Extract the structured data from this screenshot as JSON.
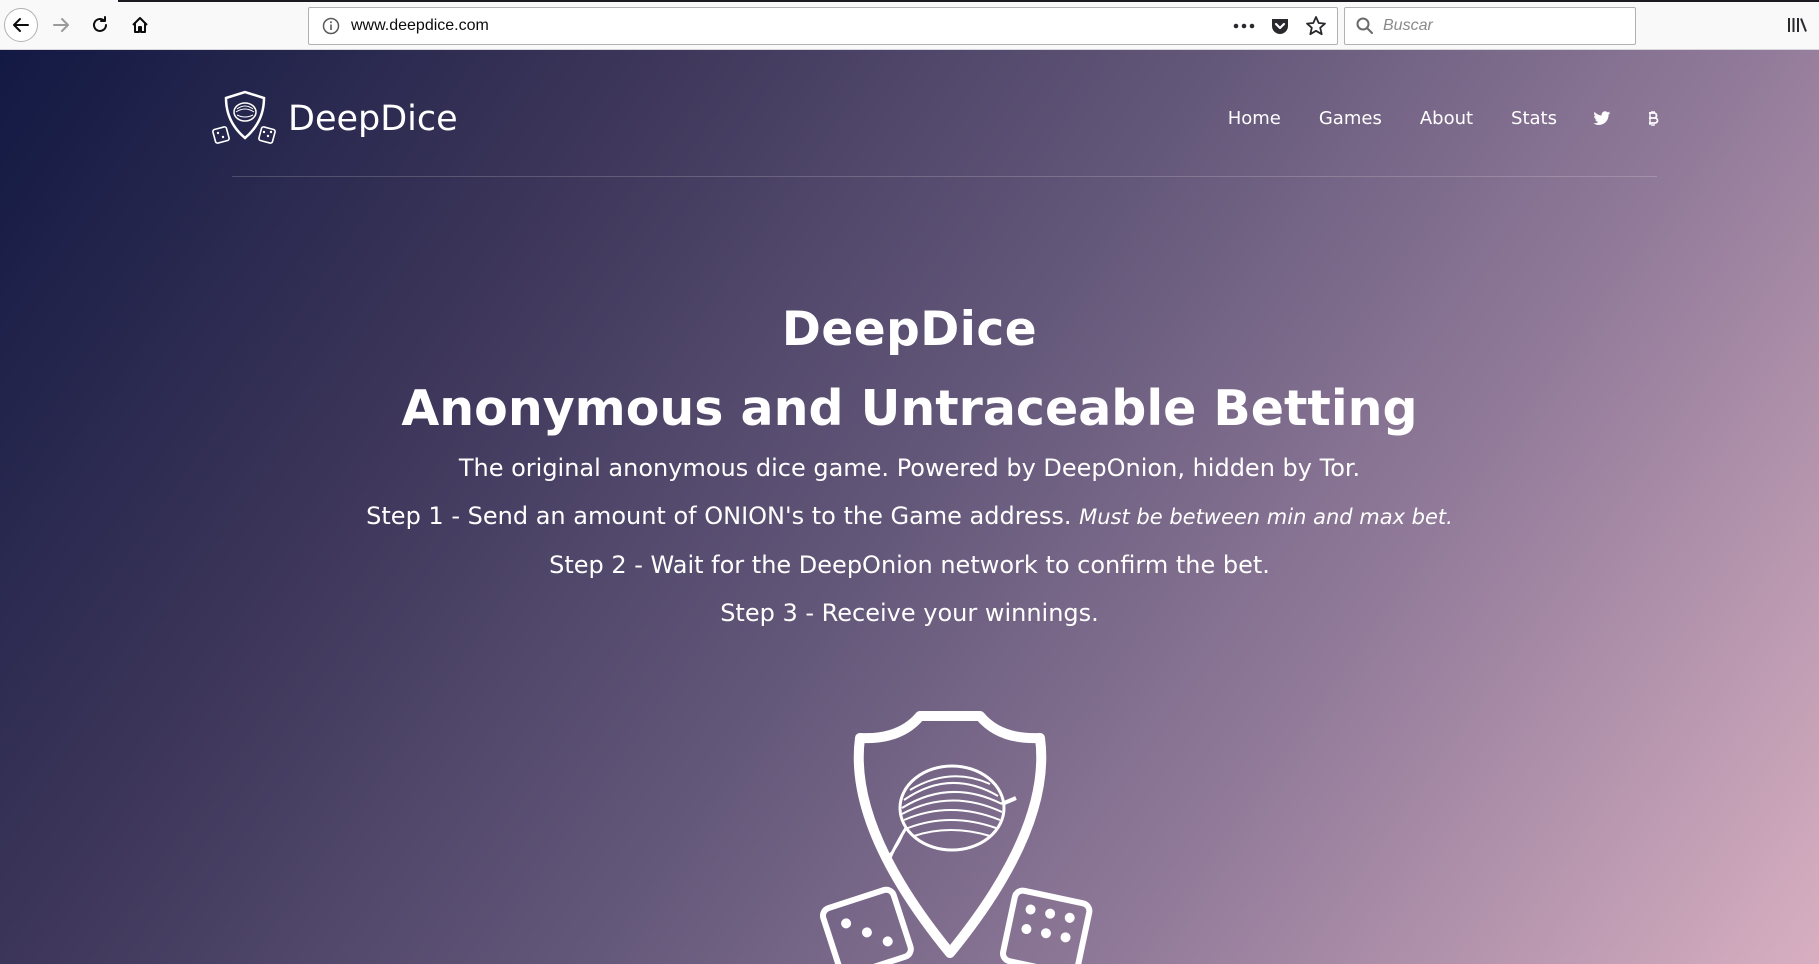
{
  "browser": {
    "url": "www.deepdice.com",
    "search_placeholder": "Buscar"
  },
  "site": {
    "brand": "DeepDice",
    "nav": [
      "Home",
      "Games",
      "About",
      "Stats"
    ]
  },
  "hero": {
    "title": "DeepDice",
    "subtitle": "Anonymous and Untraceable Betting",
    "tagline": "The original anonymous dice game. Powered by DeepOnion, hidden by Tor.",
    "step1": "Step 1 - Send an amount of ONION's to the Game address.",
    "step1_note": "Must be between min and max bet.",
    "step2": "Step 2 - Wait for the DeepOnion network to confirm the bet.",
    "step3": "Step 3 - Receive your winnings."
  },
  "colors": {
    "gradient_start": "#121943",
    "gradient_end": "#d8afc1",
    "text": "#ffffff"
  },
  "icons": [
    "back-arrow-icon",
    "forward-arrow-icon",
    "reload-icon",
    "home-icon",
    "info-icon",
    "more-icon",
    "pocket-icon",
    "star-icon",
    "search-icon",
    "library-icon",
    "twitter-icon",
    "bitcoin-icon",
    "shield-onion-dice-logo"
  ]
}
